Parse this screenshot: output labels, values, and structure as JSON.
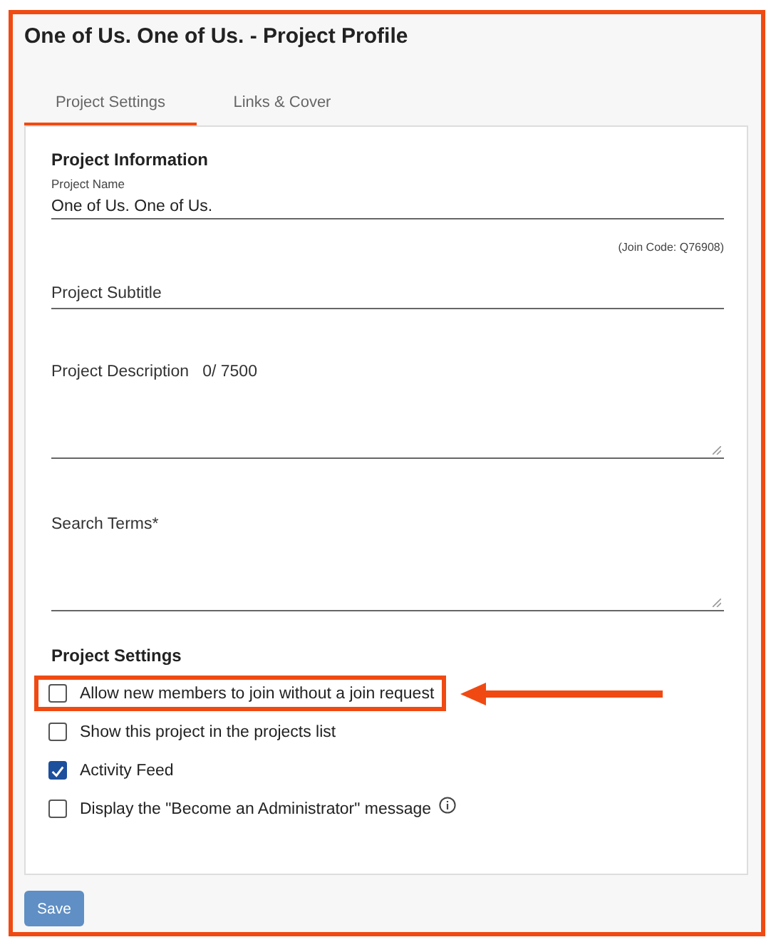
{
  "title": "One of Us. One of Us. - Project Profile",
  "tabs": [
    {
      "label": "Project Settings",
      "selected": true
    },
    {
      "label": "Links & Cover",
      "selected": false
    }
  ],
  "info_heading": "Project Information",
  "fields": [
    {
      "kind": "text",
      "label": "Project Name",
      "value": "One of Us. One of Us.",
      "note": "(Join Code: Q76908)"
    },
    {
      "kind": "line",
      "placeholder": "Project Subtitle"
    },
    {
      "kind": "area",
      "placeholder": "Project Description",
      "counter": "0/ 7500"
    },
    {
      "kind": "area",
      "placeholder": "Search Terms*"
    }
  ],
  "settings_heading": "Project Settings",
  "options": [
    {
      "label": "Allow new members to join without a join request",
      "checked": false,
      "highlighted": true
    },
    {
      "label": "Show this project in the projects list",
      "checked": false,
      "highlighted": false
    },
    {
      "label": "Activity Feed",
      "checked": true,
      "highlighted": false
    },
    {
      "label": "Display the \"Become an Administrator\" message",
      "checked": false,
      "highlighted": false,
      "info": true
    }
  ],
  "save": "Save"
}
